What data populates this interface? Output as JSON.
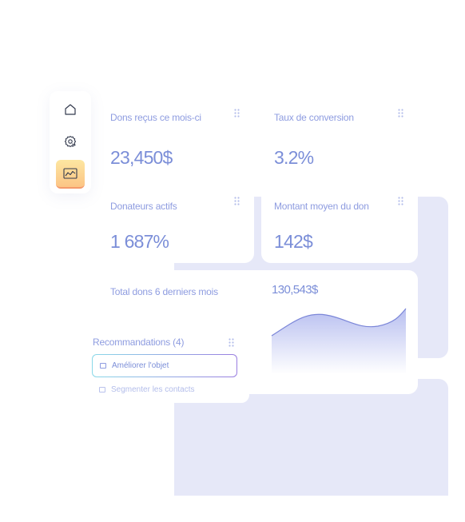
{
  "sidebar": {
    "items": [
      {
        "icon": "home-icon",
        "active": false
      },
      {
        "icon": "gear-icon",
        "active": false
      },
      {
        "icon": "chart-icon",
        "active": true
      }
    ]
  },
  "stats": [
    {
      "label": "Dons reçus ce mois-ci",
      "value": "23,450$"
    },
    {
      "label": "Taux de conversion",
      "value": "3.2%"
    },
    {
      "label": "Donateurs actifs",
      "value": "1 687%"
    },
    {
      "label": "Montant moyen du don",
      "value": "142$"
    }
  ],
  "trend": {
    "label": "Total dons 6 derniers mois",
    "value": "130,543$"
  },
  "recommendations": {
    "title": "Recommandations (4)",
    "items": [
      {
        "label": "Améliorer l'objet",
        "selected": true
      },
      {
        "label": "Segmenter les contacts",
        "selected": false
      }
    ]
  },
  "colors": {
    "accent": "#7b8ed8",
    "panel": "#e6e8f8",
    "active_tab": "#fcc585"
  }
}
